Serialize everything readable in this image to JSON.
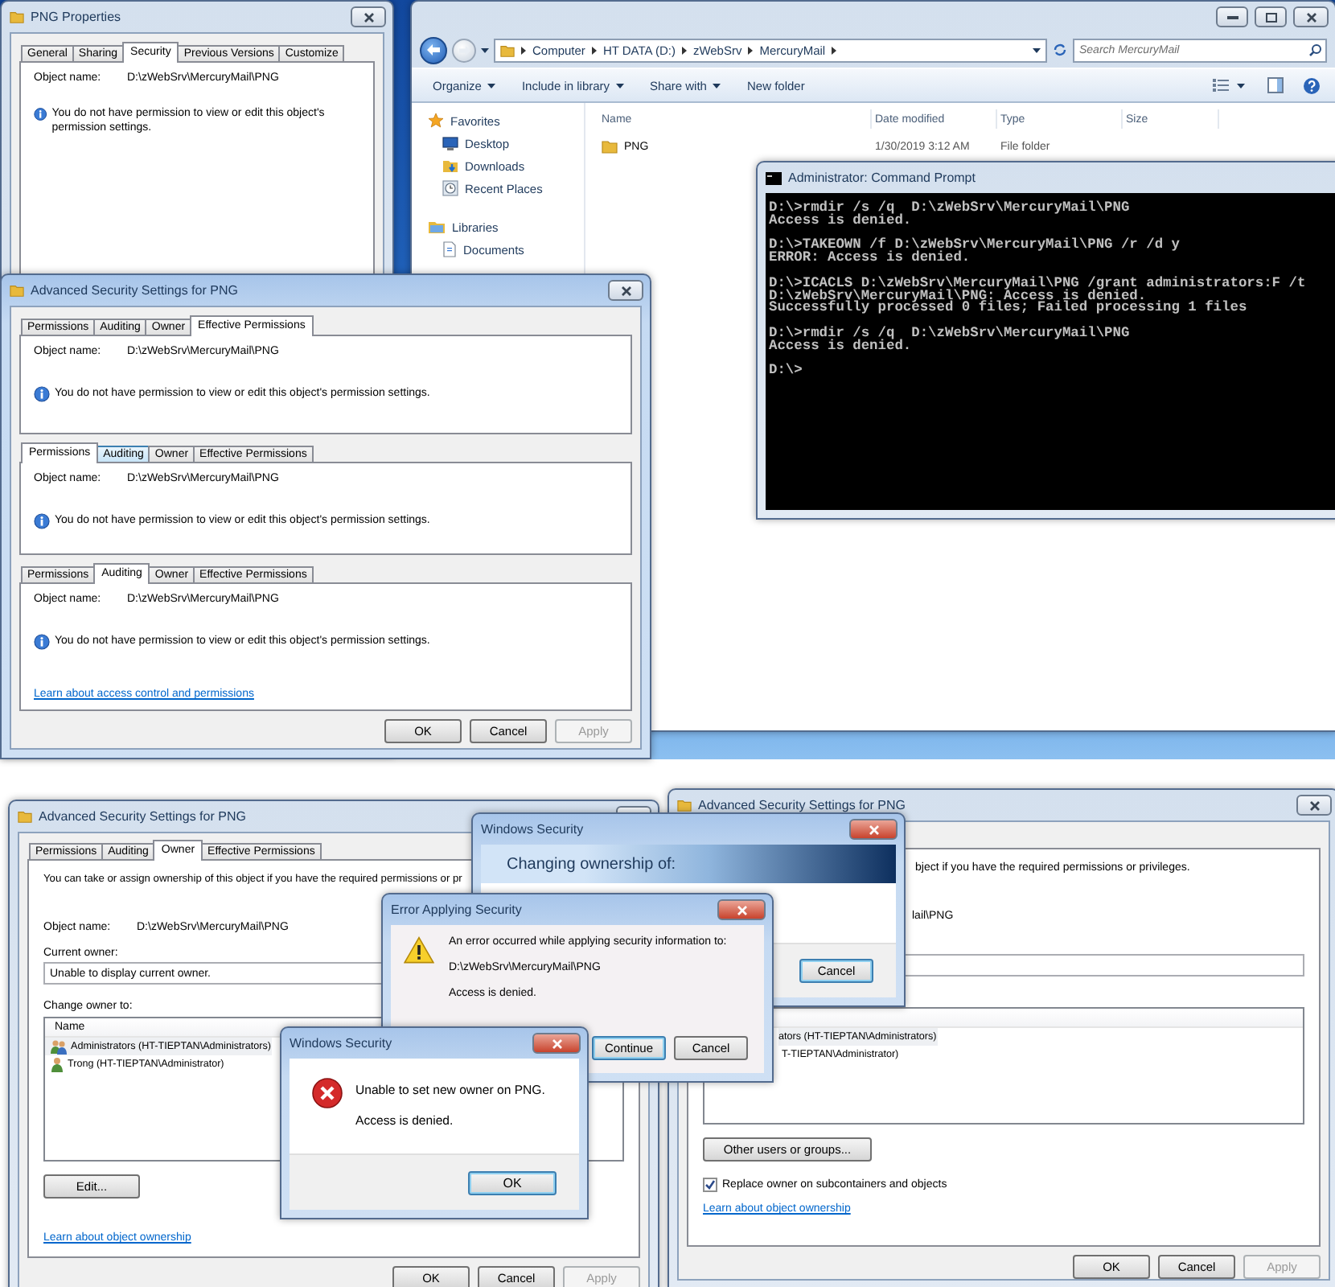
{
  "explorer": {
    "breadcrumb": [
      "Computer",
      "HT DATA (D:)",
      "zWebSrv",
      "MercuryMail"
    ],
    "search": {
      "placeholder": "Search MercuryMail"
    },
    "toolbar": [
      {
        "label": "Organize",
        "dropdown": true
      },
      {
        "label": "Include in library",
        "dropdown": true
      },
      {
        "label": "Share with",
        "dropdown": true
      },
      {
        "label": "New folder",
        "dropdown": false
      }
    ],
    "nav": [
      {
        "label": "Favorites",
        "kind": "star",
        "children": [
          {
            "label": "Desktop",
            "kind": "desktop"
          },
          {
            "label": "Downloads",
            "kind": "downloads"
          },
          {
            "label": "Recent Places",
            "kind": "recent"
          }
        ]
      },
      {
        "label": "Libraries",
        "kind": "library",
        "children": [
          {
            "label": "Documents",
            "kind": "document"
          }
        ]
      }
    ],
    "columns": [
      "Name",
      "Date modified",
      "Type",
      "Size"
    ],
    "rows": [
      {
        "name": "PNG",
        "date_modified": "1/30/2019 3:12 AM",
        "type": "File folder"
      }
    ]
  },
  "properties": {
    "title": "PNG Properties",
    "tabs": [
      {
        "label": "General",
        "selected": false
      },
      {
        "label": "Sharing",
        "selected": false
      },
      {
        "label": "Security",
        "selected": true
      },
      {
        "label": "Previous Versions",
        "selected": false
      },
      {
        "label": "Customize",
        "selected": false
      }
    ],
    "object_name_label": "Object name:",
    "object_name": "D:\\zWebSrv\\MercuryMail\\PNG",
    "message": "You do not have permission to view or edit this object's permission settings."
  },
  "advanced_top": {
    "title": "Advanced Security Settings for PNG",
    "panels": [
      {
        "tabs": [
          {
            "label": "Permissions",
            "selected": false,
            "hot": false
          },
          {
            "label": "Auditing",
            "selected": false,
            "hot": false
          },
          {
            "label": "Owner",
            "selected": false,
            "hot": false
          },
          {
            "label": "Effective Permissions",
            "selected": true,
            "hot": false
          }
        ],
        "object_name_label": "Object name:",
        "object_name": "D:\\zWebSrv\\MercuryMail\\PNG",
        "message": "You do not have permission to view or edit this object's permission settings."
      },
      {
        "tabs": [
          {
            "label": "Permissions",
            "selected": true,
            "hot": false
          },
          {
            "label": "Auditing",
            "selected": false,
            "hot": true
          },
          {
            "label": "Owner",
            "selected": false,
            "hot": false
          },
          {
            "label": "Effective Permissions",
            "selected": false,
            "hot": false
          }
        ],
        "object_name_label": "Object name:",
        "object_name": "D:\\zWebSrv\\MercuryMail\\PNG",
        "message": "You do not have permission to view or edit this object's permission settings."
      },
      {
        "tabs": [
          {
            "label": "Permissions",
            "selected": false,
            "hot": false
          },
          {
            "label": "Auditing",
            "selected": true,
            "hot": false
          },
          {
            "label": "Owner",
            "selected": false,
            "hot": false
          },
          {
            "label": "Effective Permissions",
            "selected": false,
            "hot": false
          }
        ],
        "object_name_label": "Object name:",
        "object_name": "D:\\zWebSrv\\MercuryMail\\PNG",
        "message": "You do not have permission to view or edit this object's permission settings."
      }
    ],
    "link": "Learn about access control and permissions",
    "buttons": [
      {
        "label": "OK",
        "disabled": false
      },
      {
        "label": "Cancel",
        "disabled": false
      },
      {
        "label": "Apply",
        "disabled": true
      }
    ]
  },
  "command_prompt": {
    "title": "Administrator: Command Prompt",
    "blocks": [
      [
        "D:\\>rmdir /s /q  D:\\zWebSrv\\MercuryMail\\PNG",
        "Access is denied."
      ],
      [
        "D:\\>TAKEOWN /f D:\\zWebSrv\\MercuryMail\\PNG /r /d y",
        "ERROR: Access is denied."
      ],
      [
        "D:\\>ICACLS D:\\zWebSrv\\MercuryMail\\PNG /grant administrators:F /t",
        "D:\\zWebSrv\\MercuryMail\\PNG: Access is denied.",
        "Successfully processed 0 files; Failed processing 1 files"
      ],
      [
        "D:\\>rmdir /s /q  D:\\zWebSrv\\MercuryMail\\PNG",
        "Access is denied."
      ],
      [
        "D:\\>"
      ]
    ]
  },
  "owner_left": {
    "title": "Advanced Security Settings for PNG",
    "tabs": [
      {
        "label": "Permissions",
        "selected": false
      },
      {
        "label": "Auditing",
        "selected": false
      },
      {
        "label": "Owner",
        "selected": true
      },
      {
        "label": "Effective Permissions",
        "selected": false
      }
    ],
    "intro": "You can take or assign ownership of this object if you have the required permissions or pr",
    "object_name_label": "Object name:",
    "object_name": "D:\\zWebSrv\\MercuryMail\\PNG",
    "current_owner_label": "Current owner:",
    "current_owner": "Unable to display current owner.",
    "change_owner_label": "Change owner to:",
    "list_header": "Name",
    "owners": [
      {
        "name": "Administrators (HT-TIEPTAN\\Administrators)",
        "kind": "group",
        "selected": true
      },
      {
        "name": "Trong (HT-TIEPTAN\\Administrator)",
        "kind": "user",
        "selected": false
      }
    ],
    "edit_button": "Edit...",
    "link": "Learn about object ownership",
    "buttons": [
      {
        "label": "OK",
        "disabled": false
      },
      {
        "label": "Cancel",
        "disabled": false
      },
      {
        "label": "Apply",
        "disabled": true
      }
    ]
  },
  "owner_right": {
    "title": "Advanced Security Settings for PNG",
    "intro": "bject if you have the required permissions or privileges.",
    "object_name": "lail\\PNG",
    "owners": [
      {
        "name": "ators (HT-TIEPTAN\\Administrators)",
        "selected": true
      },
      {
        "name": "T-TIEPTAN\\Administrator)",
        "selected": false
      }
    ],
    "other_users_button": "Other users or groups...",
    "replace_owner": {
      "label": "Replace owner on subcontainers and objects",
      "checked": true
    },
    "link": "Learn about object ownership",
    "buttons": [
      {
        "label": "OK",
        "disabled": false
      },
      {
        "label": "Cancel",
        "disabled": false
      },
      {
        "label": "Apply",
        "disabled": true
      }
    ]
  },
  "changing_dialog": {
    "title": "Windows Security",
    "heading": "Changing ownership of:",
    "buttons": [
      {
        "label": "Cancel",
        "default": true
      }
    ]
  },
  "error_dialog": {
    "title": "Error Applying Security",
    "lines": [
      "An error occurred while applying security information to:",
      "D:\\zWebSrv\\MercuryMail\\PNG",
      "Access is denied."
    ],
    "buttons": [
      {
        "label": "Continue",
        "default": true
      },
      {
        "label": "Cancel",
        "default": false
      }
    ]
  },
  "owner_error_dialog": {
    "title": "Windows Security",
    "lines": [
      "Unable to set new owner on PNG.",
      "Access is denied."
    ],
    "buttons": [
      {
        "label": "OK",
        "default": true
      }
    ]
  }
}
